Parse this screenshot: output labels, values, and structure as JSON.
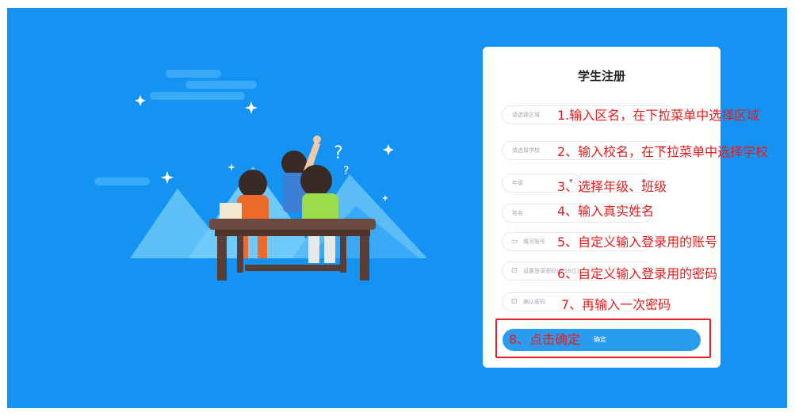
{
  "form": {
    "title": "学生注册",
    "region_placeholder": "请选择区域",
    "school_placeholder": "请选择学校",
    "grade_placeholder": "年级",
    "class_placeholder": "班级",
    "name_placeholder": "姓名",
    "account_placeholder": "填写账号",
    "password_placeholder": "设置登录密码(6-16位)",
    "confirm_placeholder": "确认密码",
    "submit_label": "确定"
  },
  "annotations": {
    "region": "1.输入区名，在下拉菜单中选择区域",
    "school": "2、输入校名，在下拉菜单中选择学校",
    "grade_class": "3、选择年级、班级",
    "name": "4、输入真实姓名",
    "account": "5、自定义输入登录用的账号",
    "password": "6、自定义输入登录用的密码",
    "confirm": "7、再输入一次密码",
    "submit": "8、点击确定"
  },
  "icons": {
    "account": "id-card-icon",
    "password": "lock-icon",
    "confirm": "lock-icon",
    "dropdown": "caret-down-icon"
  },
  "colors": {
    "background": "#1593f3",
    "card": "#ffffff",
    "button": "#2a9cf0",
    "annotation": "#e61c1c"
  }
}
